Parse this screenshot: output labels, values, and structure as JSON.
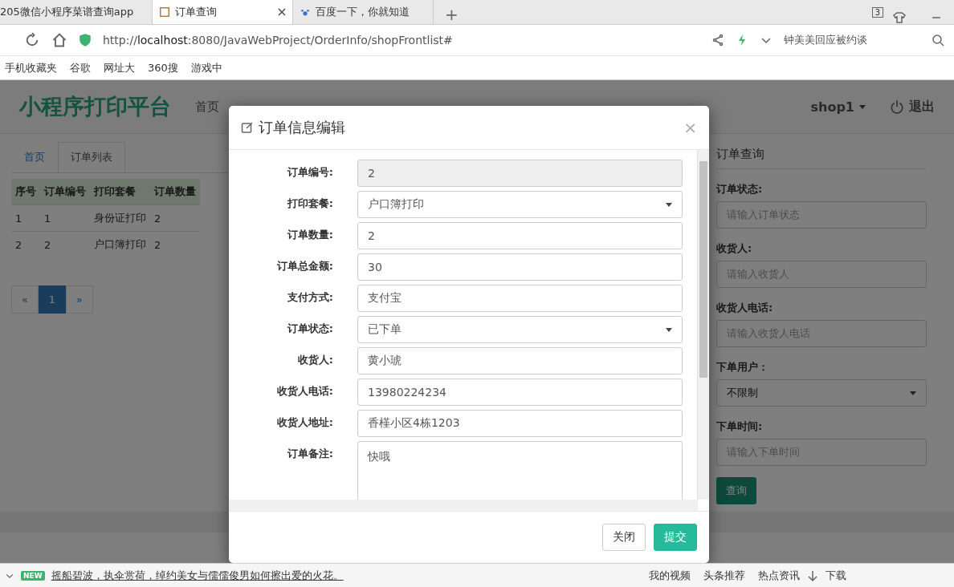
{
  "browser": {
    "tabs": [
      {
        "title": "205微信小程序菜谱查询app",
        "selected": false,
        "closable": false
      },
      {
        "title": "订单查询",
        "selected": true,
        "closable": true
      },
      {
        "title": "百度一下，你就知道",
        "selected": false,
        "closable": false
      }
    ],
    "new_tab": "+",
    "tab_count": "3",
    "url_prefix": "http://",
    "url_host": "localhost",
    "url_rest": ":8080/JavaWebProject/OrderInfo/shopFrontlist#",
    "search_hint": "钟美美回应被约谈",
    "bookmarks": [
      "手机收藏夹",
      "谷歌",
      "网址大",
      "360搜",
      "游戏中"
    ]
  },
  "navbar": {
    "brand": "小程序打印平台",
    "items": [
      "首页"
    ],
    "user": "shop1",
    "logout": "退出"
  },
  "breadcrumb": [
    {
      "label": "首页",
      "selected": false
    },
    {
      "label": "订单列表",
      "selected": true
    }
  ],
  "table": {
    "columns": [
      "序号",
      "订单编号",
      "打印套餐",
      "订单数量"
    ],
    "rows": [
      [
        "1",
        "1",
        "身份证打印",
        "2"
      ],
      [
        "2",
        "2",
        "户口簿打印",
        "2"
      ]
    ]
  },
  "pagination": [
    {
      "label": "«",
      "selected": false
    },
    {
      "label": "1",
      "selected": true
    },
    {
      "label": "»",
      "selected": false
    }
  ],
  "query_panel": {
    "title": "订单查询",
    "fields": [
      {
        "label": "订单状态:",
        "kind": "text",
        "placeholder": "请输入订单状态"
      },
      {
        "label": "收货人:",
        "kind": "text",
        "placeholder": "请输入收货人"
      },
      {
        "label": "收货人电话:",
        "kind": "text",
        "placeholder": "请输入收货人电话"
      },
      {
        "label": "下单用户：",
        "kind": "select",
        "value": "不限制"
      },
      {
        "label": "下单时间:",
        "kind": "text",
        "placeholder": "请输入下单时间"
      }
    ],
    "button": "查询"
  },
  "modal": {
    "title": "订单信息编辑",
    "close": "×",
    "fields": [
      {
        "label": "订单编号:",
        "kind": "readonly",
        "value": "2"
      },
      {
        "label": "打印套餐:",
        "kind": "select",
        "value": "户口簿打印"
      },
      {
        "label": "订单数量:",
        "kind": "text",
        "value": "2"
      },
      {
        "label": "订单总金额:",
        "kind": "text",
        "value": "30"
      },
      {
        "label": "支付方式:",
        "kind": "text",
        "value": "支付宝"
      },
      {
        "label": "订单状态:",
        "kind": "select",
        "value": "已下单"
      },
      {
        "label": "收货人:",
        "kind": "text",
        "value": "黄小琥"
      },
      {
        "label": "收货人电话:",
        "kind": "text",
        "value": "13980224234"
      },
      {
        "label": "收货人地址:",
        "kind": "text",
        "value": "香槿小区4栋1203"
      },
      {
        "label": "订单备注:",
        "kind": "textarea",
        "value": "快哦"
      }
    ],
    "buttons": [
      {
        "label": "关闭",
        "kind": "default"
      },
      {
        "label": "提交",
        "kind": "primary"
      }
    ]
  },
  "status_bar": {
    "badge": "NEW",
    "news": "摇船碧波，执伞赏荷，绰约美女与儒儒俊男如何擦出爱的火花。",
    "items": [
      "我的视频",
      "头条推荐",
      "热点资讯"
    ],
    "download": "下载"
  }
}
